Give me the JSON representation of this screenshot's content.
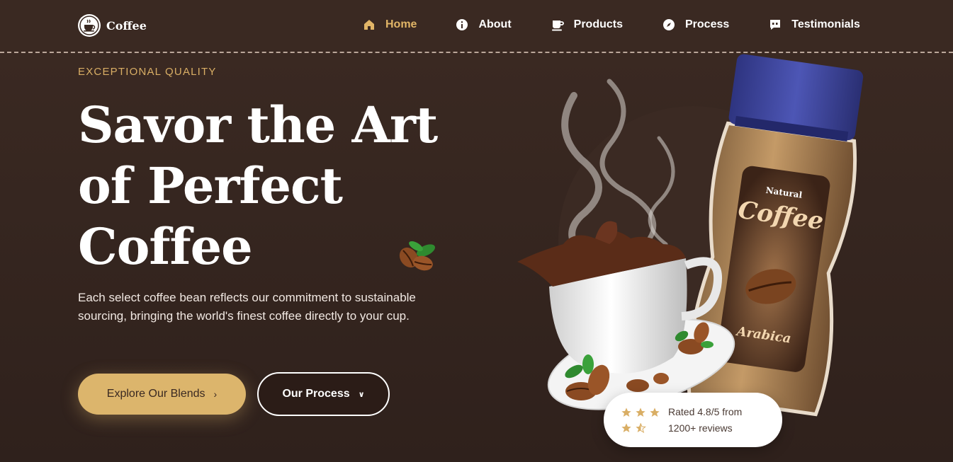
{
  "brand": {
    "name": "Coffee",
    "logo_icon": "coffee-cup-logo-icon"
  },
  "nav": {
    "items": [
      {
        "label": "Home",
        "icon": "home-icon",
        "active": true
      },
      {
        "label": "About",
        "icon": "info-icon",
        "active": false
      },
      {
        "label": "Products",
        "icon": "mug-icon",
        "active": false
      },
      {
        "label": "Process",
        "icon": "compass-icon",
        "active": false
      },
      {
        "label": "Testimonials",
        "icon": "quote-bubble-icon",
        "active": false
      }
    ]
  },
  "hero": {
    "eyebrow": "EXCEPTIONAL QUALITY",
    "headline_line1": "Savor the Art",
    "headline_line2": "of Perfect",
    "headline_line3": "Coffee",
    "subtext": "Each select coffee bean reflects our commitment to sustainable sourcing, bringing the world's finest coffee directly to your cup.",
    "primary_button": "Explore Our Blends",
    "secondary_button": "Our Process"
  },
  "product": {
    "jar_label_top": "Natural",
    "jar_label_main": "Coffee",
    "jar_label_bottom": "Arabica"
  },
  "rating": {
    "value": 4.5,
    "max": 5,
    "line1": "Rated 4.8/5 from",
    "line2": "1200+ reviews"
  },
  "colors": {
    "background": "#3a2922",
    "accent": "#dcb56c",
    "active_nav": "#e1b567",
    "jar_lid": "#3d46a0"
  }
}
